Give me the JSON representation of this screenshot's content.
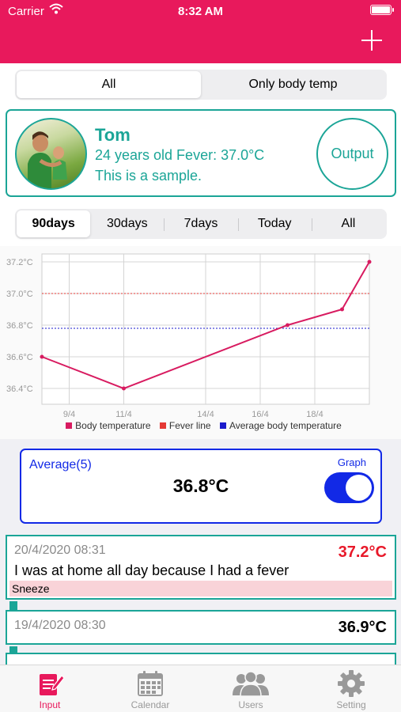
{
  "status_bar": {
    "carrier": "Carrier",
    "time": "8:32 AM"
  },
  "header": {
    "add_icon": "plus-icon"
  },
  "filter": {
    "options": [
      "All",
      "Only body temp"
    ],
    "selected": "All"
  },
  "profile": {
    "name": "Tom",
    "info": "24 years old  Fever: 37.0°C",
    "note": "This is a sample.",
    "output_label": "Output"
  },
  "ranges": {
    "options": [
      "90days",
      "30days",
      "7days",
      "Today",
      "All"
    ],
    "selected": "90days"
  },
  "chart_data": {
    "type": "line",
    "x_ticks": [
      "9/4",
      "11/4",
      "14/4",
      "16/4",
      "18/4"
    ],
    "y_ticks": [
      "36.4°C",
      "36.6°C",
      "36.8°C",
      "37.0°C",
      "37.2°C"
    ],
    "ylim": [
      36.3,
      37.25
    ],
    "series": [
      {
        "name": "Body temperature",
        "color": "#d81b60",
        "points": [
          {
            "x": "8/4",
            "y": 36.6
          },
          {
            "x": "11/4",
            "y": 36.4
          },
          {
            "x": "17/4",
            "y": 36.8
          },
          {
            "x": "19/4",
            "y": 36.9
          },
          {
            "x": "20/4",
            "y": 37.2
          }
        ]
      }
    ],
    "fever_line": {
      "name": "Fever line",
      "value": 37.0,
      "color": "#e53935"
    },
    "average_line": {
      "name": "Average body temperature",
      "value": 36.78,
      "color": "#1a1acc"
    },
    "legend": [
      "Body temperature",
      "Fever line",
      "Average body temperature"
    ],
    "legend_position": "bottom",
    "grid": true
  },
  "average": {
    "label": "Average(5)",
    "value": "36.8°C",
    "graph_label": "Graph",
    "graph_on": true
  },
  "records": [
    {
      "date": "20/4/2020 08:31",
      "temp": "37.2°C",
      "fever": true,
      "text": "I was at home all day because I had a fever",
      "tag": "Sneeze"
    },
    {
      "date": "19/4/2020 08:30",
      "temp": "36.9°C",
      "fever": false
    }
  ],
  "tabs": [
    {
      "label": "Input",
      "icon": "edit-note-icon",
      "active": true
    },
    {
      "label": "Calendar",
      "icon": "calendar-icon",
      "active": false
    },
    {
      "label": "Users",
      "icon": "users-icon",
      "active": false
    },
    {
      "label": "Setting",
      "icon": "gear-icon",
      "active": false
    }
  ],
  "colors": {
    "brand": "#e8195c",
    "teal": "#1ba597",
    "blue": "#1229e6",
    "fever": "#e8192a"
  }
}
